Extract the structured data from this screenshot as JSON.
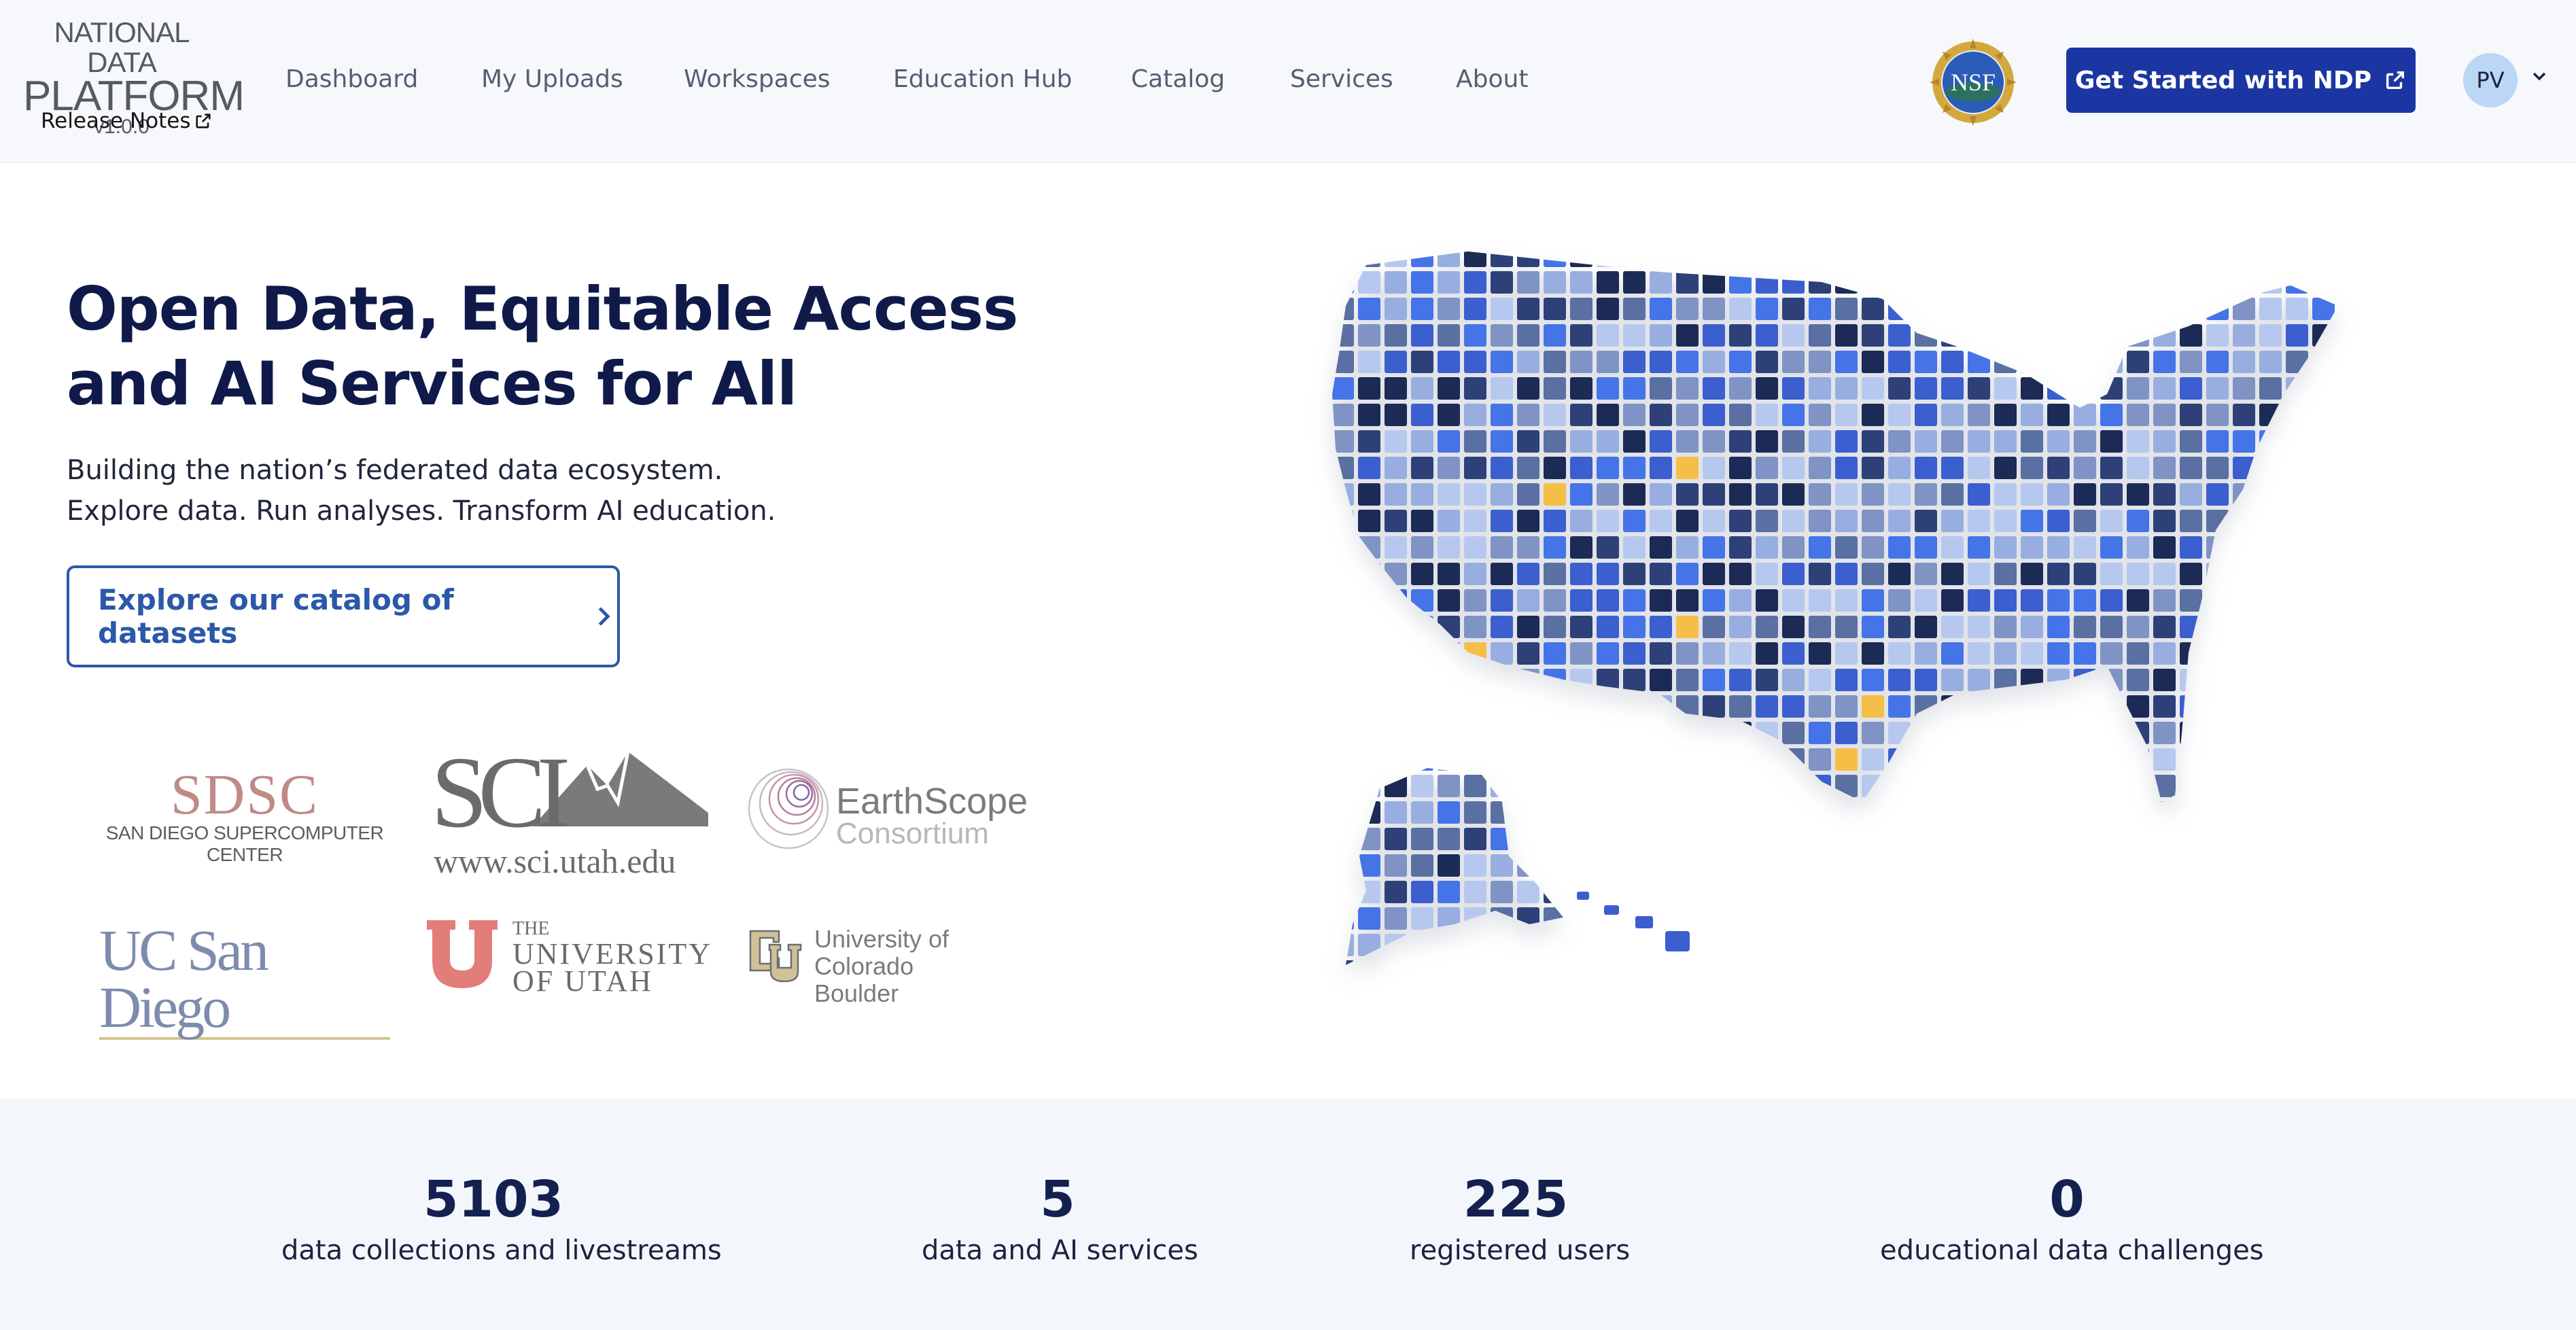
{
  "brand": {
    "line1": "NATIONAL DATA",
    "line2": "PLATFORM",
    "version": "v1.0.0",
    "release_notes": "Release Notes"
  },
  "nav": {
    "items": [
      {
        "label": "Dashboard"
      },
      {
        "label": "My Uploads"
      },
      {
        "label": "Workspaces"
      },
      {
        "label": "Education Hub"
      },
      {
        "label": "Catalog"
      },
      {
        "label": "Services"
      },
      {
        "label": "About"
      }
    ],
    "nsf_logo": "NSF",
    "cta_label": "Get Started with NDP",
    "avatar_initials": "PV"
  },
  "hero": {
    "title": "Open Data, Equitable Access and AI Services for All",
    "subtitle_line1": "Building the nation’s federated data ecosystem.",
    "subtitle_line2": "Explore data. Run analyses. Transform AI education.",
    "explore_label": "Explore our catalog of datasets"
  },
  "partners": {
    "sdsc": {
      "name": "SDSC",
      "tagline": "SAN DIEGO SUPERCOMPUTER CENTER"
    },
    "sci": {
      "name": "SCI",
      "url": "www.sci.utah.edu"
    },
    "earthscope": {
      "name": "EarthScope",
      "sub": "Consortium"
    },
    "ucsd": {
      "name": "UC San Diego"
    },
    "uofu": {
      "the": "THE",
      "line1": "UNIVERSITY",
      "line2": "OF UTAH"
    },
    "cub": {
      "line1": "University of Colorado",
      "line2": "Boulder"
    }
  },
  "stats": [
    {
      "value": "5103",
      "label": "data collections and livestreams"
    },
    {
      "value": "5",
      "label": "data and AI services"
    },
    {
      "value": "225",
      "label": "registered users"
    },
    {
      "value": "0",
      "label": "educational data challenges"
    }
  ],
  "colors": {
    "primary": "#1b36a3",
    "accent_outline": "#2b58a8",
    "title": "#0f1a4a",
    "stats_bg": "#f3f6fb",
    "map_palette": [
      "#1e2b57",
      "#2d3f78",
      "#3b5fcf",
      "#4573e8",
      "#5a6fa3",
      "#7f93c4",
      "#98aee0",
      "#b7c8ef",
      "#f5bf47"
    ]
  },
  "icons": [
    "external-link-icon",
    "chevron-right-icon",
    "chevron-down-icon",
    "nsf-seal-icon"
  ]
}
